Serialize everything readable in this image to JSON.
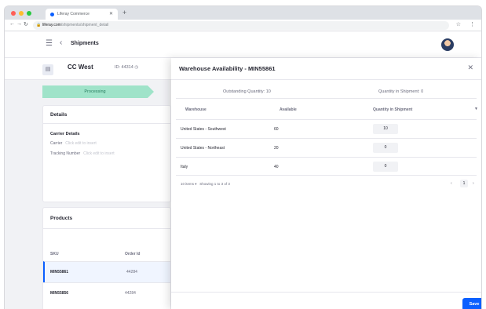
{
  "browser": {
    "tab_title": "Liferay Commerce",
    "url_host": "liferay.com",
    "url_path": "/shipments/shipment_detail"
  },
  "header": {
    "breadcrumb": "Shipments"
  },
  "shipment": {
    "name": "CC West",
    "id_label": "ID: 44314",
    "step": "Processing"
  },
  "details": {
    "title": "Details",
    "carrier_details": "Carrier Details",
    "carrier_label": "Carrier",
    "carrier_hint": "Click edit to insert",
    "tracking_label": "Tracking Number",
    "tracking_hint": "Click edit to insert"
  },
  "products": {
    "title": "Products",
    "col_sku": "SKU",
    "col_order": "Order Id",
    "rows": [
      {
        "sku": "MIN55861",
        "order": "44284"
      },
      {
        "sku": "MIN55856",
        "order": "44284"
      }
    ]
  },
  "panel": {
    "title": "Warehouse Availability - MIN55861",
    "outstanding": "Outstanding Quantity: 10",
    "in_shipment": "Quantity in Shipment: 0",
    "col_warehouse": "Warehouse",
    "col_available": "Available",
    "col_qty": "Quantity in Shipment",
    "rows": [
      {
        "warehouse": "United States - Southwest",
        "available": "60",
        "qty": "10"
      },
      {
        "warehouse": "United States - Northeast",
        "available": "20",
        "qty": "0"
      },
      {
        "warehouse": "Italy",
        "available": "40",
        "qty": "0"
      }
    ],
    "items_per_page": "10 items",
    "showing": "Showing 1 to 3 of 3",
    "page": "1",
    "save_label": "Save"
  },
  "colors": {
    "accent": "#0b5fff",
    "progress": "#9fe3c9"
  }
}
